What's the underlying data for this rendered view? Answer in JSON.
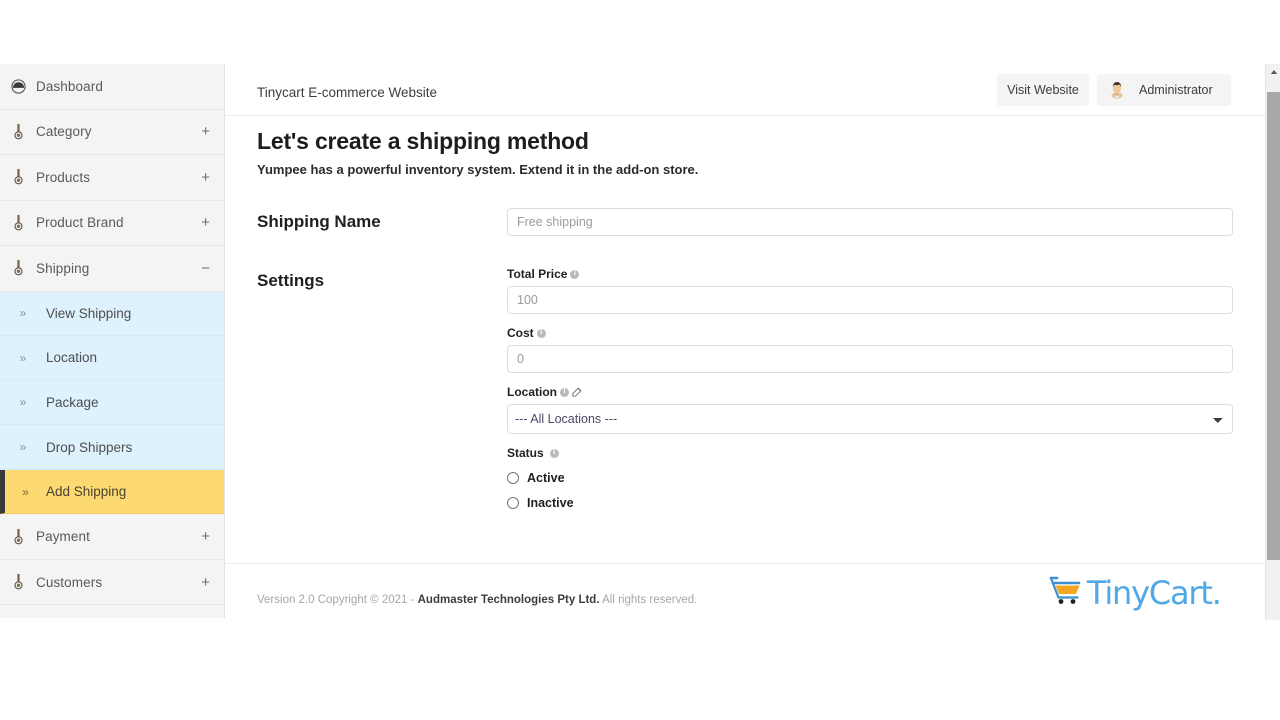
{
  "header": {
    "brand_title": "Tinycart E-commerce Website",
    "visit_website_label": "Visit Website",
    "admin_label": "Administrator",
    "avatar_icon": "user-avatar-icon"
  },
  "page": {
    "title": "Let's create a shipping method",
    "subtitle": "Yumpee has a powerful inventory system. Extend it in the add-on store."
  },
  "sidebar": {
    "items": [
      {
        "label": "Dashboard",
        "icon": "dashboard-icon",
        "expander": ""
      },
      {
        "label": "Category",
        "icon": "pin-icon",
        "expander": "+"
      },
      {
        "label": "Products",
        "icon": "pin-icon",
        "expander": "+"
      },
      {
        "label": "Product Brand",
        "icon": "pin-icon",
        "expander": "+"
      },
      {
        "label": "Shipping",
        "icon": "pin-icon",
        "expander": "−"
      }
    ],
    "submenu": [
      {
        "label": "View Shipping",
        "chevron": "»",
        "active": false
      },
      {
        "label": "Location",
        "chevron": "»",
        "active": false
      },
      {
        "label": "Package",
        "chevron": "»",
        "active": false
      },
      {
        "label": "Drop Shippers",
        "chevron": "»",
        "active": false
      },
      {
        "label": "Add Shipping",
        "chevron": "»",
        "active": true
      }
    ],
    "items_after": [
      {
        "label": "Payment",
        "icon": "pin-icon",
        "expander": "+"
      },
      {
        "label": "Customers",
        "icon": "pin-icon",
        "expander": "+"
      }
    ]
  },
  "form": {
    "shipping_name": {
      "section_label": "Shipping Name",
      "placeholder": "Free shipping",
      "value": ""
    },
    "settings": {
      "section_label": "Settings",
      "total_price": {
        "label": "Total Price",
        "placeholder": "100",
        "value": "",
        "info_icon": "info-icon"
      },
      "cost": {
        "label": "Cost",
        "placeholder": "0",
        "value": "",
        "info_icon": "info-icon"
      },
      "location": {
        "label": "Location",
        "selected": "--- All Locations ---",
        "options": [
          "--- All Locations ---"
        ],
        "info_icon": "info-icon",
        "edit_icon": "edit-pencil-icon"
      },
      "status": {
        "label": "Status",
        "info_icon": "info-icon",
        "options": [
          {
            "label": "Active",
            "checked": false
          },
          {
            "label": "Inactive",
            "checked": false
          }
        ]
      }
    }
  },
  "footer": {
    "copyright_prefix": "Version 2.0 Copyright © 2021 - ",
    "copyright_company": "Audmaster Technologies Pty Ltd.",
    "copyright_suffix": " All rights reserved.",
    "logo_text": "TinyCart.",
    "logo_cart_icon": "shopping-cart-icon"
  },
  "colors": {
    "accent_blue": "#4fa8e8",
    "cart_orange": "#f5a623",
    "submenu_bg": "#ddf2fd",
    "active_yellow": "#fcd971",
    "sidebar_bg": "#f4f4f4"
  },
  "scrollbar": {
    "up_arrow_icon": "scroll-up-arrow-icon",
    "thumb": "vertical-scroll-thumb"
  }
}
